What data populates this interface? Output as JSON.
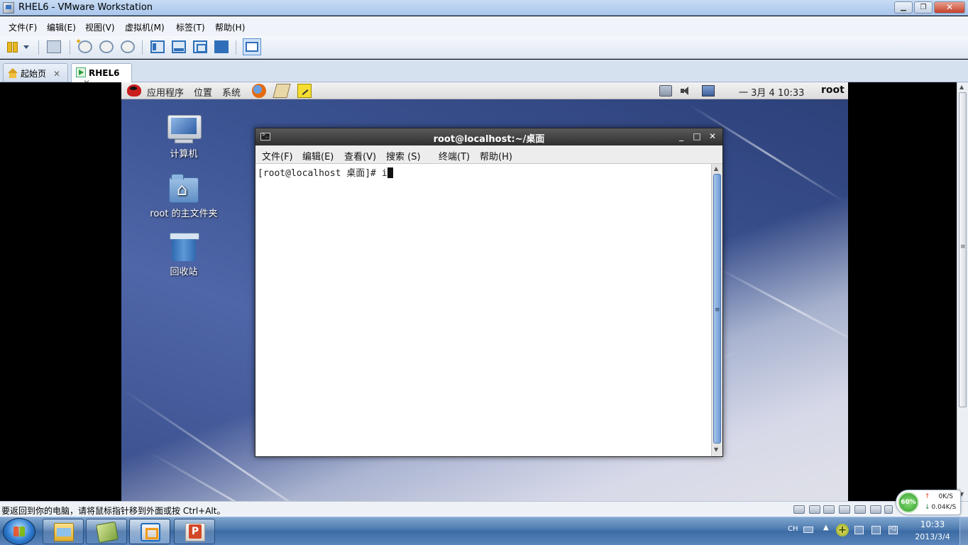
{
  "window": {
    "title": "RHEL6 - VMware Workstation",
    "controls": {
      "minimize": "▁",
      "maximize": "❐",
      "close": "✕"
    }
  },
  "menubar": [
    "文件(F)",
    "编辑(E)",
    "视图(V)",
    "虚拟机(M)",
    "标签(T)",
    "帮助(H)"
  ],
  "tabs": [
    {
      "label": "起始页",
      "close": "✕",
      "icon": "home-icon"
    },
    {
      "label": "RHEL6",
      "close": "✕",
      "icon": "vm-play-icon",
      "active": true
    }
  ],
  "guest": {
    "panel": {
      "menus": [
        "应用程序",
        "位置",
        "系统"
      ],
      "clock": "一 3月  4 10:33",
      "user": "root"
    },
    "desktop_icons": [
      {
        "label": "计算机",
        "icon": "computer-icon"
      },
      {
        "label": "root 的主文件夹",
        "icon": "home-folder-icon"
      },
      {
        "label": "回收站",
        "icon": "trash-icon"
      }
    ],
    "terminal": {
      "title": "root@localhost:~/桌面",
      "controls": {
        "minimize": "_",
        "maximize": "□",
        "close": "✕"
      },
      "menus": [
        "文件(F)",
        "编辑(E)",
        "查看(V)",
        "搜索 (S)",
        "终端(T)",
        "帮助(H)"
      ],
      "prompt": "[root@localhost 桌面]# ",
      "input": "i"
    }
  },
  "statusbar": {
    "message": "要返回到你的电脑，请将鼠标指针移到外面或按 Ctrl+Alt。"
  },
  "netmeter": {
    "percent": "60%",
    "up": "0K/S",
    "down": "0.04K/S",
    "up_arrow": "↑",
    "down_arrow": "↓"
  },
  "taskbar": {
    "lang": "CH",
    "up_arrow": "▲",
    "plus": "+",
    "time": "10:33",
    "date": "2013/3/4"
  },
  "colors": {
    "guest_panel": "#dcdcdc",
    "terminal_title": "#2f2f2f",
    "taskbar": "#4a77ad",
    "desktop": "#3c5493"
  }
}
